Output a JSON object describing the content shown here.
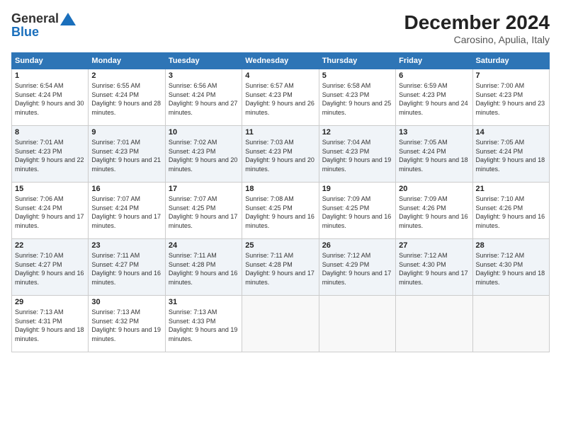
{
  "header": {
    "logo_general": "General",
    "logo_blue": "Blue",
    "title": "December 2024",
    "subtitle": "Carosino, Apulia, Italy"
  },
  "weekdays": [
    "Sunday",
    "Monday",
    "Tuesday",
    "Wednesday",
    "Thursday",
    "Friday",
    "Saturday"
  ],
  "weeks": [
    [
      {
        "day": "1",
        "sunrise": "Sunrise: 6:54 AM",
        "sunset": "Sunset: 4:24 PM",
        "daylight": "Daylight: 9 hours and 30 minutes."
      },
      {
        "day": "2",
        "sunrise": "Sunrise: 6:55 AM",
        "sunset": "Sunset: 4:24 PM",
        "daylight": "Daylight: 9 hours and 28 minutes."
      },
      {
        "day": "3",
        "sunrise": "Sunrise: 6:56 AM",
        "sunset": "Sunset: 4:24 PM",
        "daylight": "Daylight: 9 hours and 27 minutes."
      },
      {
        "day": "4",
        "sunrise": "Sunrise: 6:57 AM",
        "sunset": "Sunset: 4:23 PM",
        "daylight": "Daylight: 9 hours and 26 minutes."
      },
      {
        "day": "5",
        "sunrise": "Sunrise: 6:58 AM",
        "sunset": "Sunset: 4:23 PM",
        "daylight": "Daylight: 9 hours and 25 minutes."
      },
      {
        "day": "6",
        "sunrise": "Sunrise: 6:59 AM",
        "sunset": "Sunset: 4:23 PM",
        "daylight": "Daylight: 9 hours and 24 minutes."
      },
      {
        "day": "7",
        "sunrise": "Sunrise: 7:00 AM",
        "sunset": "Sunset: 4:23 PM",
        "daylight": "Daylight: 9 hours and 23 minutes."
      }
    ],
    [
      {
        "day": "8",
        "sunrise": "Sunrise: 7:01 AM",
        "sunset": "Sunset: 4:23 PM",
        "daylight": "Daylight: 9 hours and 22 minutes."
      },
      {
        "day": "9",
        "sunrise": "Sunrise: 7:01 AM",
        "sunset": "Sunset: 4:23 PM",
        "daylight": "Daylight: 9 hours and 21 minutes."
      },
      {
        "day": "10",
        "sunrise": "Sunrise: 7:02 AM",
        "sunset": "Sunset: 4:23 PM",
        "daylight": "Daylight: 9 hours and 20 minutes."
      },
      {
        "day": "11",
        "sunrise": "Sunrise: 7:03 AM",
        "sunset": "Sunset: 4:23 PM",
        "daylight": "Daylight: 9 hours and 20 minutes."
      },
      {
        "day": "12",
        "sunrise": "Sunrise: 7:04 AM",
        "sunset": "Sunset: 4:23 PM",
        "daylight": "Daylight: 9 hours and 19 minutes."
      },
      {
        "day": "13",
        "sunrise": "Sunrise: 7:05 AM",
        "sunset": "Sunset: 4:24 PM",
        "daylight": "Daylight: 9 hours and 18 minutes."
      },
      {
        "day": "14",
        "sunrise": "Sunrise: 7:05 AM",
        "sunset": "Sunset: 4:24 PM",
        "daylight": "Daylight: 9 hours and 18 minutes."
      }
    ],
    [
      {
        "day": "15",
        "sunrise": "Sunrise: 7:06 AM",
        "sunset": "Sunset: 4:24 PM",
        "daylight": "Daylight: 9 hours and 17 minutes."
      },
      {
        "day": "16",
        "sunrise": "Sunrise: 7:07 AM",
        "sunset": "Sunset: 4:24 PM",
        "daylight": "Daylight: 9 hours and 17 minutes."
      },
      {
        "day": "17",
        "sunrise": "Sunrise: 7:07 AM",
        "sunset": "Sunset: 4:25 PM",
        "daylight": "Daylight: 9 hours and 17 minutes."
      },
      {
        "day": "18",
        "sunrise": "Sunrise: 7:08 AM",
        "sunset": "Sunset: 4:25 PM",
        "daylight": "Daylight: 9 hours and 16 minutes."
      },
      {
        "day": "19",
        "sunrise": "Sunrise: 7:09 AM",
        "sunset": "Sunset: 4:25 PM",
        "daylight": "Daylight: 9 hours and 16 minutes."
      },
      {
        "day": "20",
        "sunrise": "Sunrise: 7:09 AM",
        "sunset": "Sunset: 4:26 PM",
        "daylight": "Daylight: 9 hours and 16 minutes."
      },
      {
        "day": "21",
        "sunrise": "Sunrise: 7:10 AM",
        "sunset": "Sunset: 4:26 PM",
        "daylight": "Daylight: 9 hours and 16 minutes."
      }
    ],
    [
      {
        "day": "22",
        "sunrise": "Sunrise: 7:10 AM",
        "sunset": "Sunset: 4:27 PM",
        "daylight": "Daylight: 9 hours and 16 minutes."
      },
      {
        "day": "23",
        "sunrise": "Sunrise: 7:11 AM",
        "sunset": "Sunset: 4:27 PM",
        "daylight": "Daylight: 9 hours and 16 minutes."
      },
      {
        "day": "24",
        "sunrise": "Sunrise: 7:11 AM",
        "sunset": "Sunset: 4:28 PM",
        "daylight": "Daylight: 9 hours and 16 minutes."
      },
      {
        "day": "25",
        "sunrise": "Sunrise: 7:11 AM",
        "sunset": "Sunset: 4:28 PM",
        "daylight": "Daylight: 9 hours and 17 minutes."
      },
      {
        "day": "26",
        "sunrise": "Sunrise: 7:12 AM",
        "sunset": "Sunset: 4:29 PM",
        "daylight": "Daylight: 9 hours and 17 minutes."
      },
      {
        "day": "27",
        "sunrise": "Sunrise: 7:12 AM",
        "sunset": "Sunset: 4:30 PM",
        "daylight": "Daylight: 9 hours and 17 minutes."
      },
      {
        "day": "28",
        "sunrise": "Sunrise: 7:12 AM",
        "sunset": "Sunset: 4:30 PM",
        "daylight": "Daylight: 9 hours and 18 minutes."
      }
    ],
    [
      {
        "day": "29",
        "sunrise": "Sunrise: 7:13 AM",
        "sunset": "Sunset: 4:31 PM",
        "daylight": "Daylight: 9 hours and 18 minutes."
      },
      {
        "day": "30",
        "sunrise": "Sunrise: 7:13 AM",
        "sunset": "Sunset: 4:32 PM",
        "daylight": "Daylight: 9 hours and 19 minutes."
      },
      {
        "day": "31",
        "sunrise": "Sunrise: 7:13 AM",
        "sunset": "Sunset: 4:33 PM",
        "daylight": "Daylight: 9 hours and 19 minutes."
      },
      null,
      null,
      null,
      null
    ]
  ]
}
